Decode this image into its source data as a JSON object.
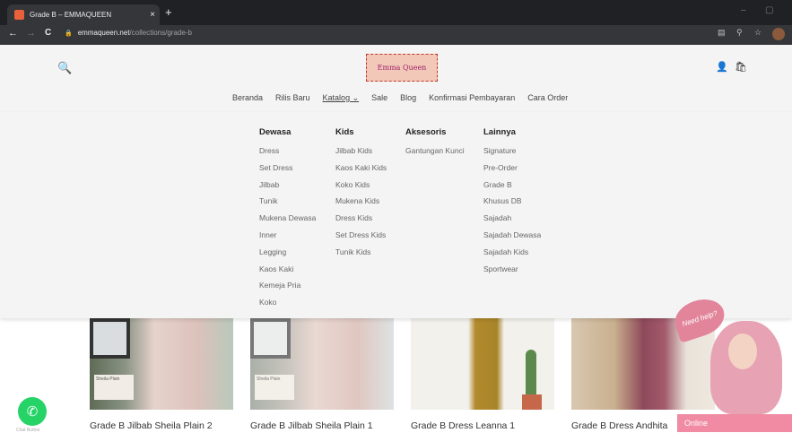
{
  "browser": {
    "tab_title": "Grade B – EMMAQUEEN",
    "tab_close": "×",
    "new_tab": "+",
    "win_min": "–",
    "win_max": "▢",
    "back": "←",
    "forward": "→",
    "reload": "C",
    "url_host": "emmaqueen.net",
    "url_path": "/collections/grade-b",
    "lock": "🔒",
    "tb_icons": [
      "▤",
      "⚲",
      "☆"
    ]
  },
  "header": {
    "search_icon": "🔍",
    "logo_text": "Emma Queen",
    "account_icon": "👤",
    "cart_icon": "🛍",
    "nav": [
      {
        "label": "Beranda"
      },
      {
        "label": "Rilis Baru"
      },
      {
        "label": "Katalog ⌄"
      },
      {
        "label": "Sale"
      },
      {
        "label": "Blog"
      },
      {
        "label": "Konfirmasi Pembayaran"
      },
      {
        "label": "Cara Order"
      }
    ]
  },
  "mega_menu": {
    "columns": [
      {
        "heading": "Dewasa",
        "items": [
          "Dress",
          "Set Dress",
          "Jilbab",
          "Tunik",
          "Mukena Dewasa",
          "Inner",
          "Legging",
          "Kaos Kaki",
          "Kemeja Pria",
          "Koko"
        ]
      },
      {
        "heading": "Kids",
        "items": [
          "Jilbab Kids",
          "Kaos Kaki Kids",
          "Koko Kids",
          "Mukena Kids",
          "Dress Kids",
          "Set Dress Kids",
          "Tunik Kids"
        ]
      },
      {
        "heading": "Aksesoris",
        "items": [
          "Gantungan Kunci"
        ]
      },
      {
        "heading": "Lainnya",
        "items": [
          "Signature",
          "Pre-Order",
          "Grade B",
          "Khusus DB",
          "Sajadah",
          "Sajadah Dewasa",
          "Sajadah Kids",
          "Sportwear"
        ]
      }
    ]
  },
  "products": [
    {
      "title": "Grade B Jilbab Sheila Plain 2",
      "tag": "Sheila Plain"
    },
    {
      "title": "Grade B Jilbab Sheila Plain 1",
      "tag": "Sheila Plain"
    },
    {
      "title": "Grade B Dress Leanna 1",
      "tag": ""
    },
    {
      "title": "Grade B Dress Andhita",
      "tag": ""
    }
  ],
  "widgets": {
    "whatsapp_icon": "✆",
    "whatsapp_label": "Chat Button",
    "help_text": "Need help?",
    "online_label": "Online"
  },
  "colors": {
    "chrome_dark": "#202124",
    "toolbar": "#35363a",
    "header_bg": "#f4f4f4",
    "whatsapp": "#25d366",
    "online_badge": "#f08ba3",
    "brand_pink": "#a0206b"
  }
}
